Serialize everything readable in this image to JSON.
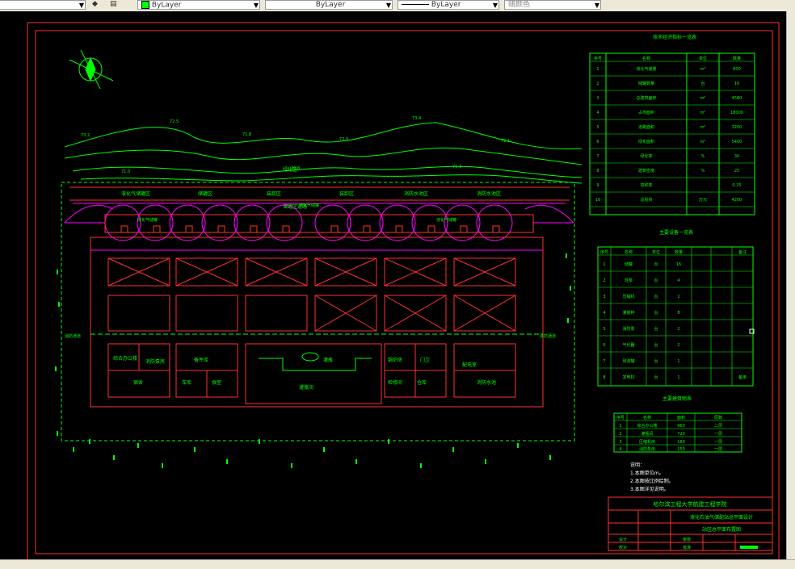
{
  "toolbar": {
    "layer_color": "ByLayer",
    "linetype": "ByLayer",
    "lineweight": "ByLayer",
    "plot_style": "随颜色"
  },
  "drawing": {
    "stat_table_title": "技术经济指标一览表",
    "stat_headers": [
      "序号",
      "名称",
      "单位",
      "数量"
    ],
    "stat_rows": [
      [
        "1",
        "液化气储量",
        "m³",
        "800"
      ],
      [
        "2",
        "储罐数量",
        "台",
        "16"
      ],
      [
        "3",
        "总建筑面积",
        "m²",
        "4580"
      ],
      [
        "4",
        "占地面积",
        "m²",
        "18000"
      ],
      [
        "5",
        "道路面积",
        "m²",
        "3200"
      ],
      [
        "6",
        "绿化面积",
        "m²",
        "5400"
      ],
      [
        "7",
        "绿化率",
        "%",
        "30"
      ],
      [
        "8",
        "建筑密度",
        "%",
        "25"
      ],
      [
        "9",
        "容积率",
        "",
        "0.25"
      ],
      [
        "10",
        "总投资",
        "万元",
        "4200"
      ]
    ],
    "equip_table_title": "主要设备一览表",
    "equip_headers": [
      "序号",
      "名称",
      "单位",
      "数量",
      "备注"
    ],
    "equip_rows": [
      [
        "1",
        "储罐",
        "台",
        "16",
        ""
      ],
      [
        "2",
        "烃泵",
        "台",
        "4",
        ""
      ],
      [
        "3",
        "压缩机",
        "台",
        "2",
        ""
      ],
      [
        "4",
        "灌装秤",
        "台",
        "8",
        ""
      ],
      [
        "5",
        "消防泵",
        "台",
        "2",
        ""
      ],
      [
        "6",
        "气化器",
        "台",
        "2",
        ""
      ],
      [
        "7",
        "残液罐",
        "台",
        "1",
        ""
      ],
      [
        "8",
        "发电机",
        "台",
        "1",
        "备用"
      ]
    ],
    "bldg_table_title": "主要建筑物表",
    "bldg_headers": [
      "序号",
      "名称",
      "面积",
      "层数"
    ],
    "bldg_rows": [
      [
        "1",
        "综合办公楼",
        "960",
        "二层"
      ],
      [
        "2",
        "灌瓶间",
        "720",
        "一层"
      ],
      [
        "3",
        "压缩机房",
        "180",
        "一层"
      ],
      [
        "4",
        "消防泵房",
        "150",
        "一层"
      ]
    ],
    "notes_title": "说明：",
    "notes": [
      "1.本图单位m。",
      "2.本图按比例绘制。",
      "3.本图详见说明。"
    ],
    "school_name": "哈尔滨工程大学航建工程学院",
    "project_name": "液化石油气储配站总平面设计",
    "drawing_name": "站区总平面布置图",
    "zones": [
      "液化气储罐区",
      "储罐区",
      "装卸区",
      "装卸区",
      "消防水池区",
      "消防水池区"
    ],
    "labels": {
      "road_top": "储罐区道路",
      "gate_left": "消防通道",
      "gate_right": "消防通道",
      "tank_label": "液化气储罐",
      "center_label": "灌瓶",
      "office": "综合办公楼",
      "pump": "消防泵房",
      "store": "备件库",
      "bottle": "灌瓶间",
      "dorm": "宿舍",
      "canteen": "食堂",
      "garage": "车库",
      "boiler": "锅炉房",
      "guard": "门卫",
      "repair": "检修间",
      "store2": "仓库",
      "power": "配电室",
      "tank_small": "水罐",
      "pool": "消防水池",
      "lake": "绿化区"
    },
    "sign_labels": [
      "设计",
      "校对",
      "审核",
      "批准"
    ]
  }
}
